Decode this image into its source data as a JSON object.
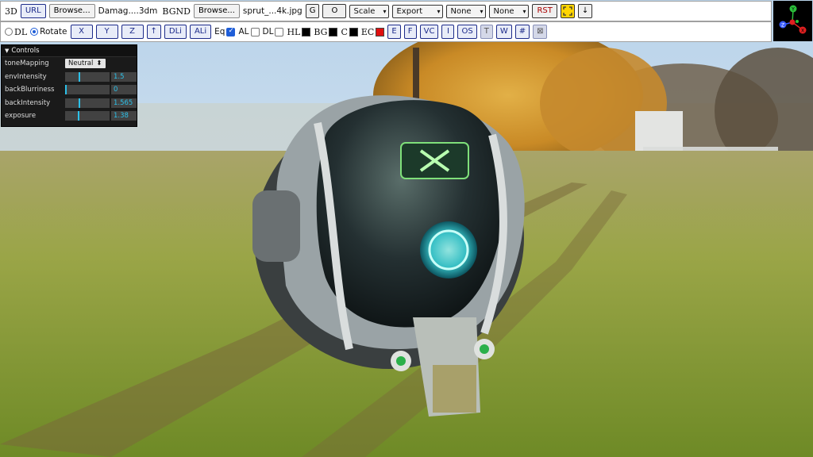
{
  "toolbar1": {
    "model_label": "3D",
    "url_button": "URL",
    "model_browse_button": "Browse...",
    "model_filename": "Damag....3dm",
    "bgnd_label": "BGND",
    "bgnd_browse_button": "Browse...",
    "bgnd_filename": "sprut_...4k.jpg",
    "g_button": "G",
    "o_button": "O",
    "scale_select": "Scale",
    "export_select": "Export",
    "none_select_1": "None",
    "none_select_2": "None",
    "rst_button": "RST",
    "arrow_down_button": "↓"
  },
  "toolbar2": {
    "dl_radio_label": "DL",
    "rotate_radio_label": "Rotate",
    "rotate_selected": true,
    "x_button": "X",
    "y_button": "Y",
    "z_button": "Z",
    "up_button": "↑",
    "dli_button": "DLi",
    "ali_button": "ALi",
    "eq_label": "Eq",
    "eq_checked": true,
    "al_label": "AL",
    "dl_check_label": "DL",
    "hl_label": "HL",
    "bg_label": "BG",
    "c_label": "C",
    "ec_label": "EC",
    "hl_color": "#000000",
    "bg_color": "#000000",
    "c_color": "#000000",
    "ec_color": "#e01010",
    "e_button": "E",
    "f_button": "F",
    "vc_button": "VC",
    "i_button": "I",
    "os_button": "OS",
    "t_button": "T",
    "w_button": "W",
    "hash_button": "#",
    "grid_button": "⊠"
  },
  "gizmo": {
    "y_label": "Y",
    "z_label": "Z",
    "x_label": "X"
  },
  "controls": {
    "title": "Controls",
    "tone_mapping_label": "toneMapping",
    "tone_mapping_value": "Neutral",
    "rows": [
      {
        "label": "envIntensity",
        "value": "1.5",
        "fraction": 0.3
      },
      {
        "label": "backBlurriness",
        "value": "0",
        "fraction": 0.0
      },
      {
        "label": "backIntensity",
        "value": "1.565",
        "fraction": 0.31
      },
      {
        "label": "exposure",
        "value": "1.38",
        "fraction": 0.28
      }
    ]
  }
}
